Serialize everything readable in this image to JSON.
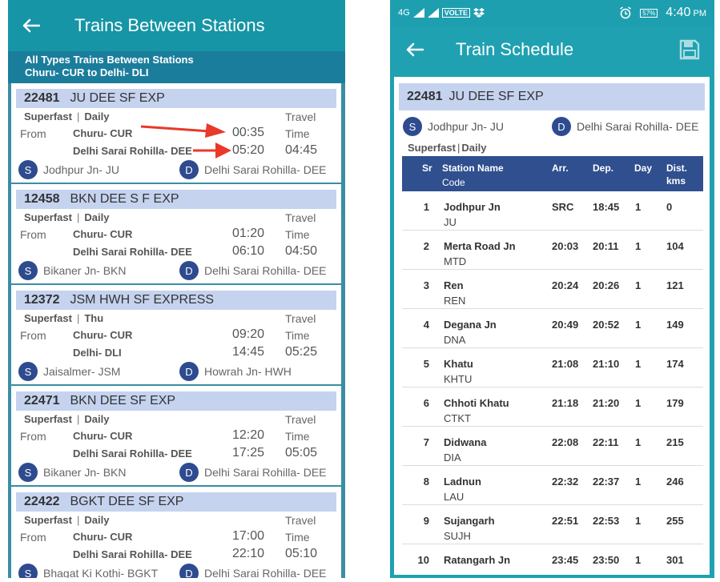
{
  "left": {
    "title": "Trains Between Stations",
    "subhead_line1": "All Types Trains Between Stations",
    "subhead_line2": "Churu- CUR  to Delhi- DLI",
    "travel_label": "Travel",
    "time_label": "Time",
    "from_label": "From",
    "src_badge": "S",
    "dst_badge": "D",
    "trains": [
      {
        "number": "22481",
        "name": "JU DEE SF EXP",
        "type": "Superfast",
        "days": "Daily",
        "from_station": "Churu- CUR",
        "to_station": "Delhi Sarai Rohilla- DEE",
        "dep": "00:35",
        "arr": "05:20",
        "duration": "04:45",
        "source": "Jodhpur Jn- JU",
        "destination": "Delhi Sarai Rohilla- DEE"
      },
      {
        "number": "12458",
        "name": "BKN DEE S F EXP",
        "type": "Superfast",
        "days": "Daily",
        "from_station": "Churu- CUR",
        "to_station": "Delhi Sarai Rohilla- DEE",
        "dep": "01:20",
        "arr": "06:10",
        "duration": "04:50",
        "source": "Bikaner Jn- BKN",
        "destination": "Delhi Sarai Rohilla- DEE"
      },
      {
        "number": "12372",
        "name": "JSM HWH SF EXPRESS",
        "type": "Superfast",
        "days": "Thu",
        "from_station": "Churu- CUR",
        "to_station": "Delhi- DLI",
        "dep": "09:20",
        "arr": "14:45",
        "duration": "05:25",
        "source": "Jaisalmer- JSM",
        "destination": "Howrah Jn- HWH"
      },
      {
        "number": "22471",
        "name": "BKN DEE SF EXP",
        "type": "Superfast",
        "days": "Daily",
        "from_station": "Churu- CUR",
        "to_station": "Delhi Sarai Rohilla- DEE",
        "dep": "12:20",
        "arr": "17:25",
        "duration": "05:05",
        "source": "Bikaner Jn- BKN",
        "destination": "Delhi Sarai Rohilla- DEE"
      },
      {
        "number": "22422",
        "name": "BGKT DEE SF EXP",
        "type": "Superfast",
        "days": "Daily",
        "from_station": "Churu- CUR",
        "to_station": "Delhi Sarai Rohilla- DEE",
        "dep": "17:00",
        "arr": "22:10",
        "duration": "05:10",
        "source": "Bhagat Ki Kothi- BGKT",
        "destination": "Delhi Sarai Rohilla- DEE"
      }
    ]
  },
  "right": {
    "status": {
      "network": "4G",
      "volte": "VOLTE",
      "battery": "57%",
      "time": "4:40",
      "ampm": "PM"
    },
    "title": "Train Schedule",
    "train_number": "22481",
    "train_name": "JU DEE SF EXP",
    "source": "Jodhpur Jn- JU",
    "destination": "Delhi Sarai Rohilla- DEE",
    "src_badge": "S",
    "dst_badge": "D",
    "type": "Superfast",
    "days": "Daily",
    "headers": {
      "sr": "Sr",
      "station": "Station Name",
      "code": "Code",
      "arr": "Arr.",
      "dep": "Dep.",
      "day": "Day",
      "dist1": "Dist.",
      "dist2": "kms"
    },
    "rows": [
      {
        "sr": "1",
        "name": "Jodhpur Jn",
        "code": "JU",
        "arr": "SRC",
        "dep": "18:45",
        "day": "1",
        "dist": "0"
      },
      {
        "sr": "2",
        "name": "Merta Road Jn",
        "code": "MTD",
        "arr": "20:03",
        "dep": "20:11",
        "day": "1",
        "dist": "104"
      },
      {
        "sr": "3",
        "name": "Ren",
        "code": "REN",
        "arr": "20:24",
        "dep": "20:26",
        "day": "1",
        "dist": "121"
      },
      {
        "sr": "4",
        "name": "Degana Jn",
        "code": "DNA",
        "arr": "20:49",
        "dep": "20:52",
        "day": "1",
        "dist": "149"
      },
      {
        "sr": "5",
        "name": "Khatu",
        "code": "KHTU",
        "arr": "21:08",
        "dep": "21:10",
        "day": "1",
        "dist": "174"
      },
      {
        "sr": "6",
        "name": "Chhoti Khatu",
        "code": "CTKT",
        "arr": "21:18",
        "dep": "21:20",
        "day": "1",
        "dist": "179"
      },
      {
        "sr": "7",
        "name": "Didwana",
        "code": "DIA",
        "arr": "22:08",
        "dep": "22:11",
        "day": "1",
        "dist": "215"
      },
      {
        "sr": "8",
        "name": "Ladnun",
        "code": "LAU",
        "arr": "22:32",
        "dep": "22:37",
        "day": "1",
        "dist": "246"
      },
      {
        "sr": "9",
        "name": "Sujangarh",
        "code": "SUJH",
        "arr": "22:51",
        "dep": "22:53",
        "day": "1",
        "dist": "255"
      },
      {
        "sr": "10",
        "name": "Ratangarh Jn",
        "code": "",
        "arr": "23:45",
        "dep": "23:50",
        "day": "1",
        "dist": "301"
      }
    ]
  },
  "colors": {
    "appbar": "#1695a6",
    "band": "#c5d3ef",
    "badge": "#2e4b8f",
    "table_header": "#2f4f8f",
    "annotation_arrow": "#e8392a"
  }
}
